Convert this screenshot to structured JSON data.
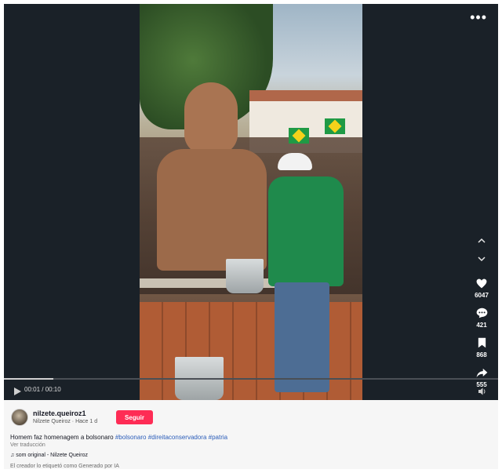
{
  "player": {
    "more_icon": "ellipsis-icon",
    "time_label": "00:01 / 00:10",
    "progress": 0.1
  },
  "actions": {
    "likes": "6047",
    "comments": "421",
    "saves": "868",
    "shares": "555"
  },
  "author": {
    "username": "nilzete.queiroz1",
    "display_name": "Nilzete Queiroz",
    "separator": " · ",
    "posted": "Hace 1 d",
    "follow_label": "Seguir"
  },
  "post": {
    "caption_text": "Homem faz homenagem a bolsonaro ",
    "hashtags": [
      "#bolsonaro",
      "#direitaconservadora",
      "#patria"
    ],
    "translate_label": "Ver traducción",
    "sound_label": "som original - Nilzete Queiroz",
    "ai_label": "El creador lo etiquetó como Generado por IA"
  },
  "colors": {
    "accent": "#fe2c55",
    "hashtag": "#2b5db9",
    "player_bg": "#1a2128"
  }
}
